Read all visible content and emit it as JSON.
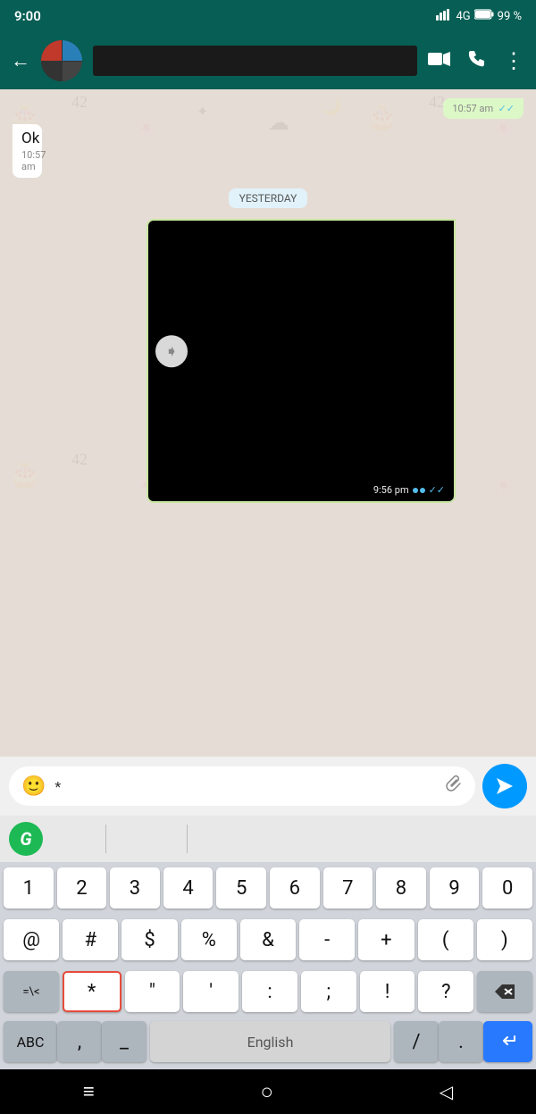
{
  "status_bar": {
    "time": "9:00",
    "signal": "4G",
    "battery": "99 %"
  },
  "header": {
    "contact_name": "",
    "video_icon": "video-camera",
    "call_icon": "phone",
    "more_icon": "three-dots"
  },
  "messages": [
    {
      "type": "incoming_cut",
      "text": "",
      "time": "10:57 am",
      "read": true
    },
    {
      "type": "outgoing",
      "text": "Ok",
      "time": "10:57 am"
    },
    {
      "type": "date_badge",
      "text": "YESTERDAY"
    },
    {
      "type": "video",
      "time": "9:56 pm",
      "read": true
    }
  ],
  "input_bar": {
    "placeholder": "*",
    "emoji_label": "emoji",
    "attach_label": "attach",
    "send_label": "send"
  },
  "keyboard": {
    "grammarly_label": "G",
    "number_row": [
      "1",
      "2",
      "3",
      "4",
      "5",
      "6",
      "7",
      "8",
      "9",
      "0"
    ],
    "symbols_row1": [
      "@",
      "#",
      "$",
      "%",
      "&",
      "-",
      "+",
      "(",
      ")"
    ],
    "symbols_row2_left": "=\\<",
    "symbols_row2": [
      "*",
      "\"",
      "'",
      ":",
      ";",
      "!",
      "?"
    ],
    "bottom_row": {
      "abc": "ABC",
      "comma": ",",
      "underscore": "_",
      "space": "English",
      "slash": "/",
      "dot": ".",
      "enter": "↵"
    }
  },
  "nav_bar": {
    "menu_icon": "≡",
    "home_icon": "○",
    "back_icon": "◁"
  }
}
